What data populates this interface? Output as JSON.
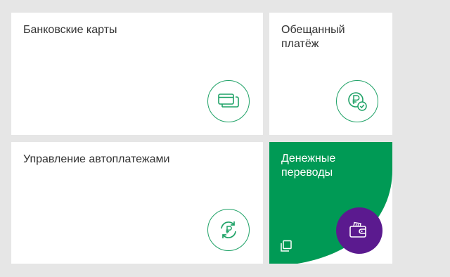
{
  "tiles": {
    "bank_cards": {
      "title": "Банковские карты",
      "icon": "bank-cards-icon"
    },
    "promised_payment": {
      "title": "Обещанный\nплатёж",
      "icon": "ruble-check-icon"
    },
    "autopayments": {
      "title": "Управление автоплатежами",
      "icon": "ruble-refresh-icon"
    },
    "money_transfers": {
      "title": "Денежные\nпереводы",
      "icon": "wallet-icon"
    }
  },
  "colors": {
    "accent_green": "#1fa267",
    "tile_green": "#009a55",
    "wallet_purple": "#5b1a8f",
    "background": "#e6e6e6"
  }
}
